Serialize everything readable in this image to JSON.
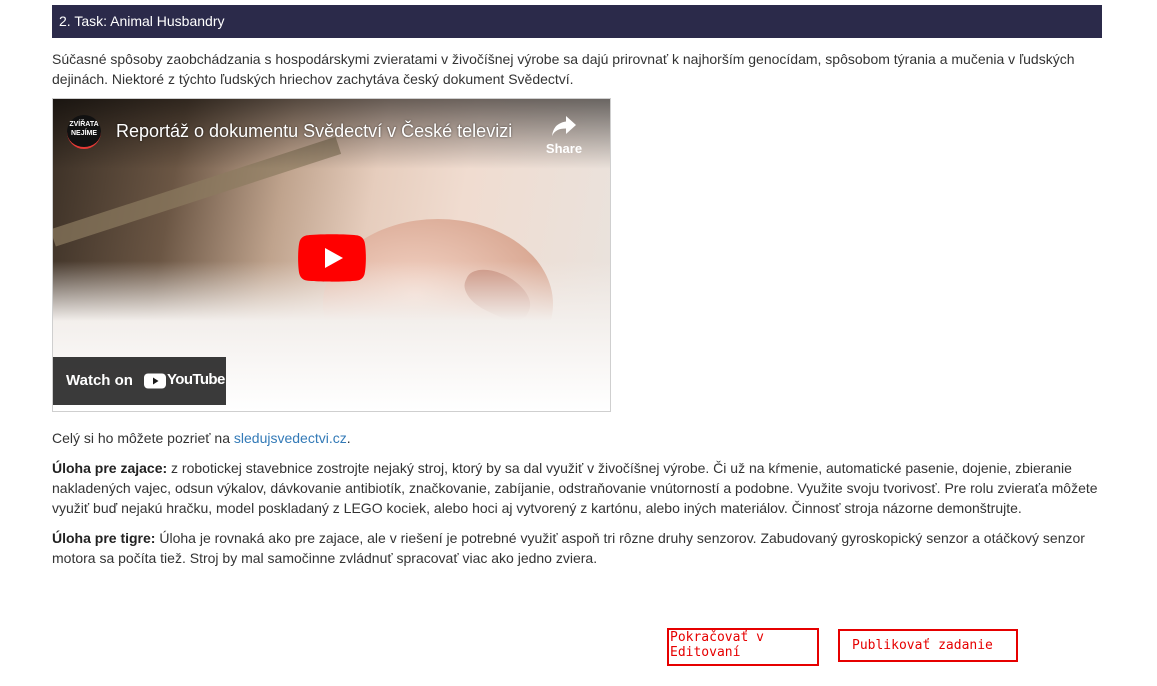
{
  "task": {
    "title": "2. Task: Animal Husbandry"
  },
  "intro": {
    "text": "Súčasné spôsoby zaobchádzania s hospodárskymi zvieratami v živočíšnej výrobe sa dajú prirovnať k najhorším genocídam, spôsobom týrania a mučenia v ľudských dejinách. Niektoré z týchto ľudských hriechov zachytáva český dokument Svědectví."
  },
  "video": {
    "channel_logo_text": "ZVÍŘATA NEJÍME",
    "title": "Reportáž o dokumentu Svědectví v České televizi",
    "share_label": "Share",
    "watch_on_label": "Watch on",
    "youtube_word": "YouTube",
    "icons": {
      "play": "play-icon",
      "share": "share-icon",
      "youtube": "youtube-logo-icon"
    },
    "colors": {
      "play": "#ff0000"
    }
  },
  "watch": {
    "prefix": "Celý si ho môžete pozrieť na ",
    "link_text": "sledujsvedectvi.cz",
    "suffix": "."
  },
  "task_zajace": {
    "label": "Úloha pre zajace:",
    "text": " z robotickej stavebnice zostrojte nejaký stroj, ktorý by sa dal využiť v živočíšnej výrobe. Či už na kŕmenie, automatické pasenie, dojenie, zbieranie nakladených vajec, odsun výkalov, dávkovanie antibiotík, značkovanie, zabíjanie, odstraňovanie vnútorností a podobne. Využite svoju tvorivosť. Pre rolu zvieraťa môžete využiť buď nejakú hračku, model poskladaný z LEGO kociek, alebo hoci aj vytvorený z kartónu, alebo iných materiálov. Činnosť stroja názorne demonštrujte."
  },
  "task_tigre": {
    "label": "Úloha pre tigre:",
    "text": " Úloha je rovnaká ako pre zajace, ale v riešení je potrebné využiť aspoň tri rôzne druhy senzorov. Zabudovaný gyroskopický senzor a otáčkový senzor motora sa počíta tiež. Stroj by mal samočinne zvládnuť spracovať viac ako jedno zviera."
  },
  "buttons": {
    "continue_label": "Pokračovať v Editovaní",
    "publish_label": "Publikovať zadanie"
  },
  "colors": {
    "header_bg": "#2b2a4a",
    "link": "#337ab7",
    "button_accent": "#e60000"
  }
}
